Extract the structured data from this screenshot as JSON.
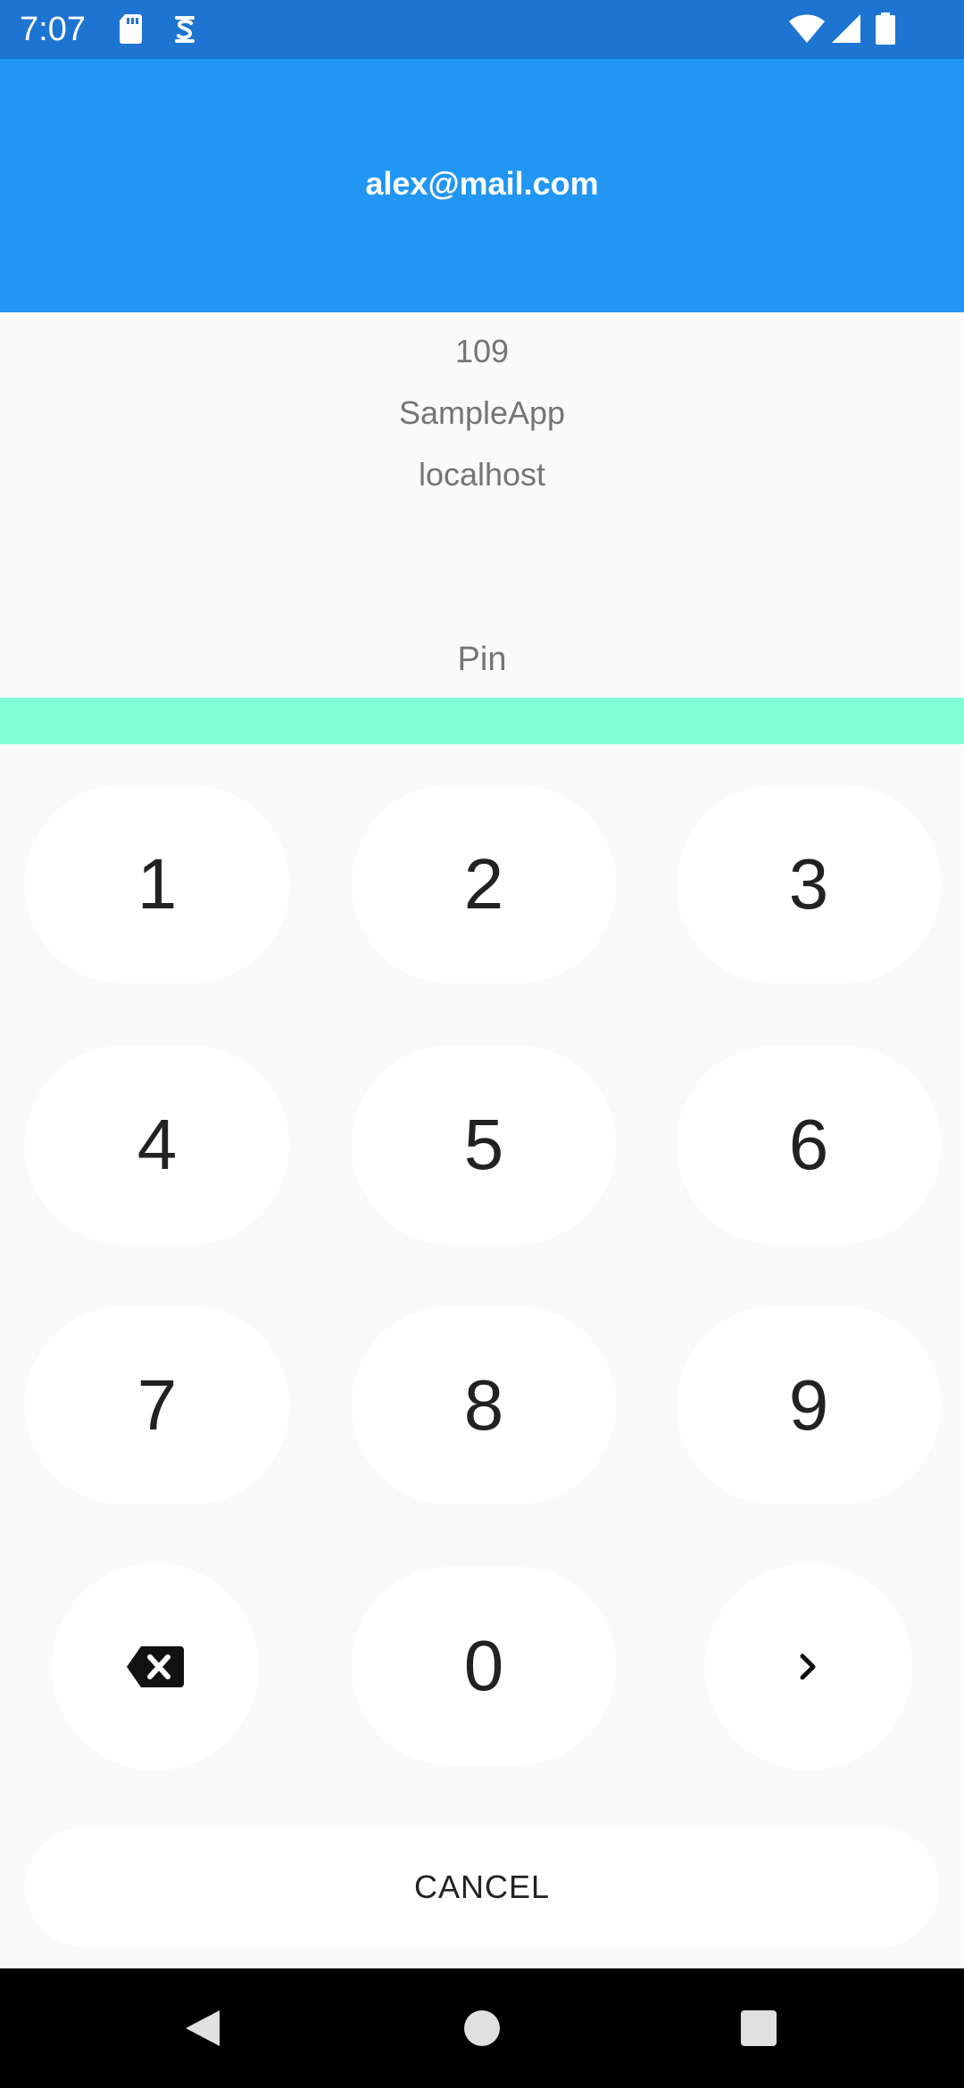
{
  "status_bar": {
    "time": "7:07",
    "icons": [
      "sd-card-icon",
      "s-app-icon",
      "wifi-icon",
      "signal-icon",
      "battery-icon"
    ]
  },
  "header": {
    "title": "alex@mail.com"
  },
  "info": {
    "number": "109",
    "app_name": "SampleApp",
    "host": "localhost"
  },
  "pin": {
    "label": "Pin",
    "value": ""
  },
  "keypad": {
    "keys": [
      "1",
      "2",
      "3",
      "4",
      "5",
      "6",
      "7",
      "8",
      "9",
      "0"
    ],
    "backspace_icon": "backspace-icon",
    "next_icon": "chevron-right-icon"
  },
  "cancel_label": "CANCEL",
  "colors": {
    "status_bar": "#1e74d1",
    "header": "#2196f3",
    "pin_field": "#80ffd4",
    "background": "#fafafa"
  }
}
